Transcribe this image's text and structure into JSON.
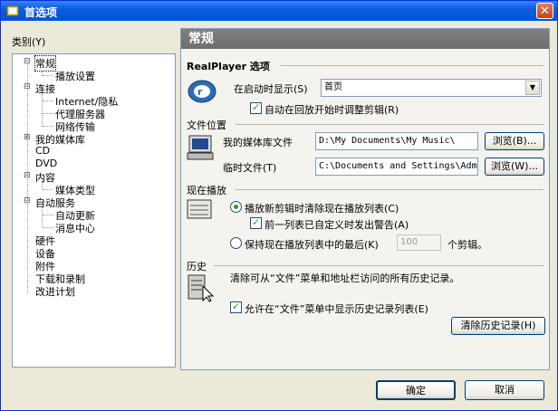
{
  "window": {
    "title": "首选项",
    "close_glyph": "✕"
  },
  "category_label": "类别(Y)",
  "tree": {
    "expand_minus": "⊟",
    "expand_plus": "⊞",
    "items": [
      "常规",
      "播放设置",
      "连接",
      "Internet/隐私",
      "代理服务器",
      "网络传输",
      "我的媒体库",
      "CD",
      "DVD",
      "内容",
      "媒体类型",
      "自动服务",
      "自动更新",
      "消息中心",
      "硬件",
      "设备",
      "附件",
      "下载和录制",
      "改进计划"
    ]
  },
  "panel": {
    "header": "常规",
    "realplayer": {
      "title": "RealPlayer 选项",
      "startup_label": "在启动时显示(S)",
      "startup_value": "首页",
      "auto_adjust_label": "自动在回放开始时调整剪辑(R)"
    },
    "file_location": {
      "title": "文件位置",
      "library_label": "我的媒体库文件",
      "library_path": "D:\\My Documents\\My Music\\",
      "temp_label": "临时文件(T)",
      "temp_path": "C:\\Documents and Settings\\Adm",
      "browse1": "浏览(B)...",
      "browse2": "浏览(W)..."
    },
    "now_playing": {
      "title": "现在播放",
      "opt1_label": "播放新剪辑时清除现在播放列表(C)",
      "warn_label": "前一列表已自定义时发出警告(A)",
      "opt2_label": "保持现在播放列表中的最后(K)",
      "keep_count": "100",
      "clips_suffix": "个剪辑。"
    },
    "history": {
      "title": "历史",
      "description": "清除可从“文件”菜单和地址栏访问的所有历史记录。",
      "show_label": "允许在“文件”菜单中显示历史记录列表(E)",
      "clear_button": "清除历史记录(H)"
    }
  },
  "buttons": {
    "ok": "确定",
    "cancel": "取消"
  }
}
